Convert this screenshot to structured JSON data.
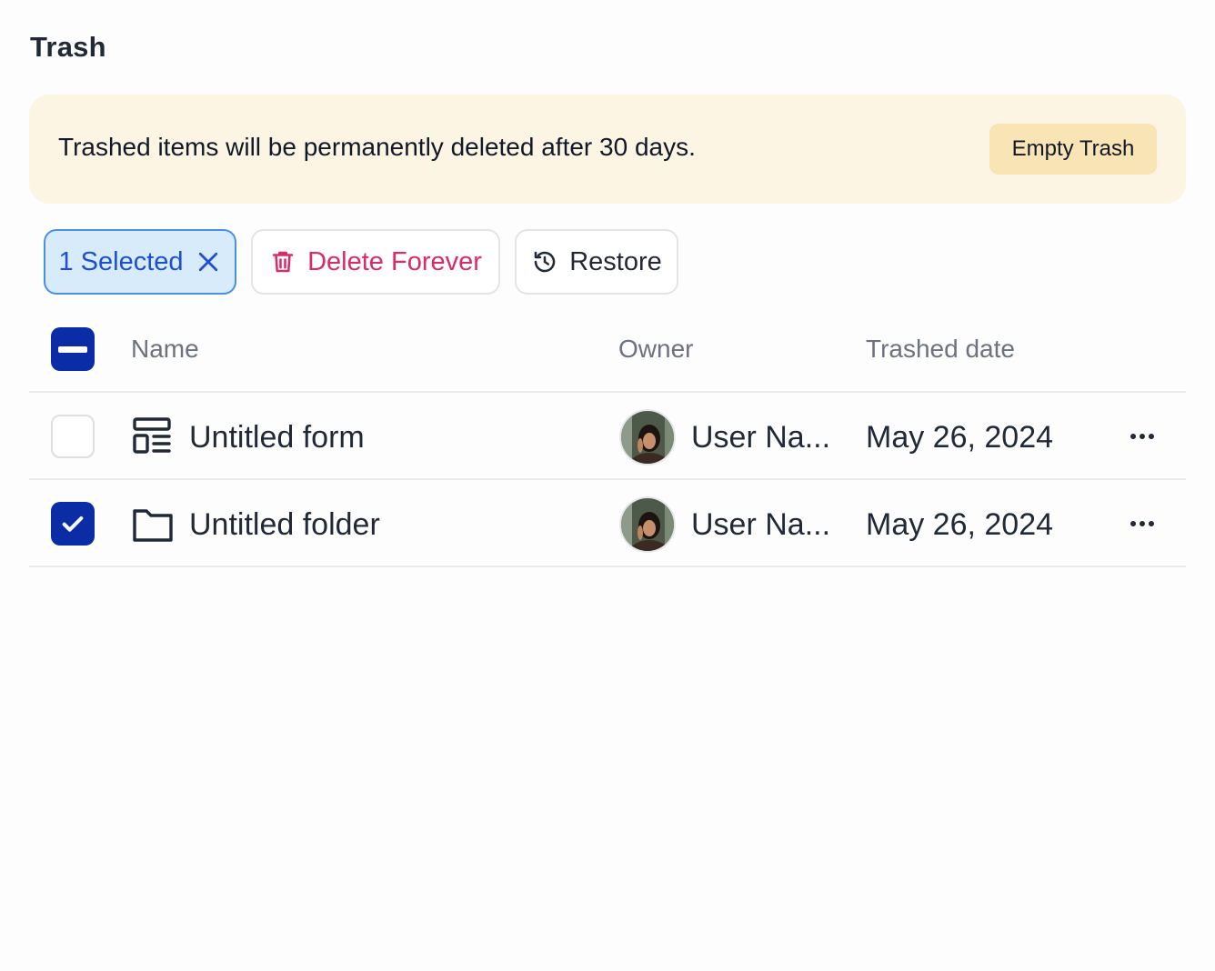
{
  "page": {
    "title": "Trash"
  },
  "banner": {
    "message": "Trashed items will be permanently deleted after 30 days.",
    "empty_trash_label": "Empty Trash"
  },
  "toolbar": {
    "selected_label": "1 Selected",
    "delete_label": "Delete Forever",
    "restore_label": "Restore"
  },
  "table": {
    "headers": {
      "name": "Name",
      "owner": "Owner",
      "date": "Trashed date"
    },
    "rows": [
      {
        "name": "Untitled form",
        "type_icon": "form-icon",
        "owner": "User Na...",
        "date": "May 26, 2024",
        "checked": false
      },
      {
        "name": "Untitled folder",
        "type_icon": "folder-icon",
        "owner": "User Na...",
        "date": "May 26, 2024",
        "checked": true
      }
    ]
  },
  "colors": {
    "accent": "#0a2da6",
    "selected_bg": "#d8ebfb",
    "danger": "#db2a6a",
    "banner_bg": "#fdf5e4",
    "banner_button": "#f8e4b4"
  }
}
